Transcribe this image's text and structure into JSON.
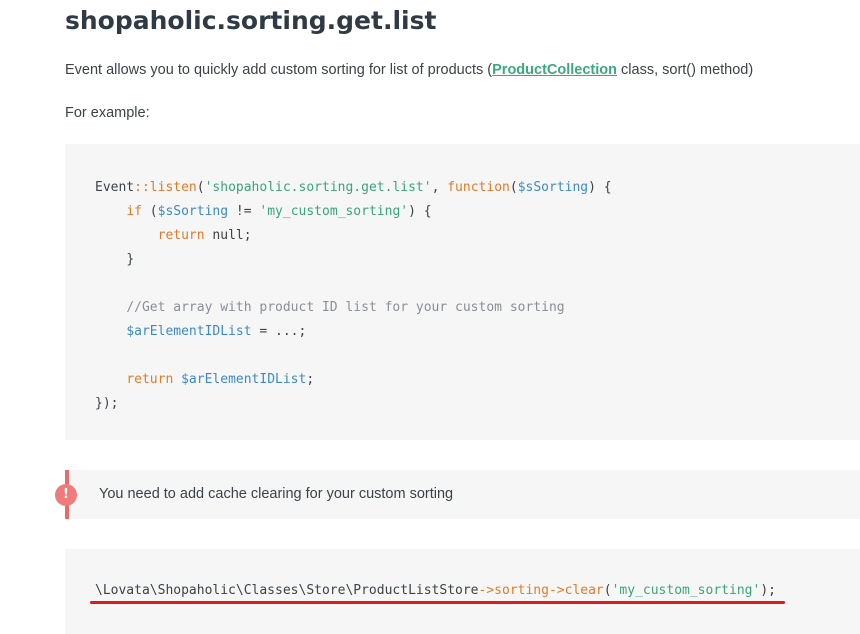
{
  "page": {
    "title": "shopaholic.sorting.get.list",
    "description": {
      "before": "Event allows you to quickly add custom sorting for list of products (",
      "link": "ProductCollection",
      "after": " class, sort() method)"
    },
    "example_label": "For example:"
  },
  "code1": {
    "l1": {
      "a": "Event",
      "b": "::",
      "c": "listen",
      "d": "(",
      "e": "'shopaholic.sorting.get.list'",
      "f": ", ",
      "g": "function",
      "h": "(",
      "i": "$sSorting",
      "j": ") {"
    },
    "l2": {
      "indent": "    ",
      "a": "if",
      "b": " (",
      "c": "$sSorting",
      "d": " != ",
      "e": "'my_custom_sorting'",
      "f": ") {"
    },
    "l3": {
      "indent": "        ",
      "a": "return",
      "b": " null;"
    },
    "l4": {
      "indent": "    ",
      "a": "}"
    },
    "l6": {
      "indent": "    ",
      "a": "//Get array with product ID list for your custom sorting"
    },
    "l7": {
      "indent": "    ",
      "a": "$arElementIDList",
      "b": " = ...;"
    },
    "l9": {
      "indent": "    ",
      "a": "return",
      "b": " ",
      "c": "$arElementIDList",
      "d": ";"
    },
    "l10": {
      "a": "});"
    }
  },
  "notice": {
    "icon": "!",
    "text": "You need to add cache clearing for your custom sorting"
  },
  "code2": {
    "a": "\\Lovata\\Shopaholic\\Classes\\Store\\ProductListStore",
    "b": "->",
    "c": "sorting",
    "d": "->",
    "e": "clear",
    "f": "(",
    "g": "'my_custom_sorting'",
    "h": ");"
  },
  "colors": {
    "accent_link": "#3aaa7a",
    "keyword": "#e07b2a",
    "string": "#3aa57c",
    "variable": "#3d8ac7",
    "comment": "#8a8f96",
    "notice": "#e86b6b",
    "underline": "#e0191b"
  }
}
